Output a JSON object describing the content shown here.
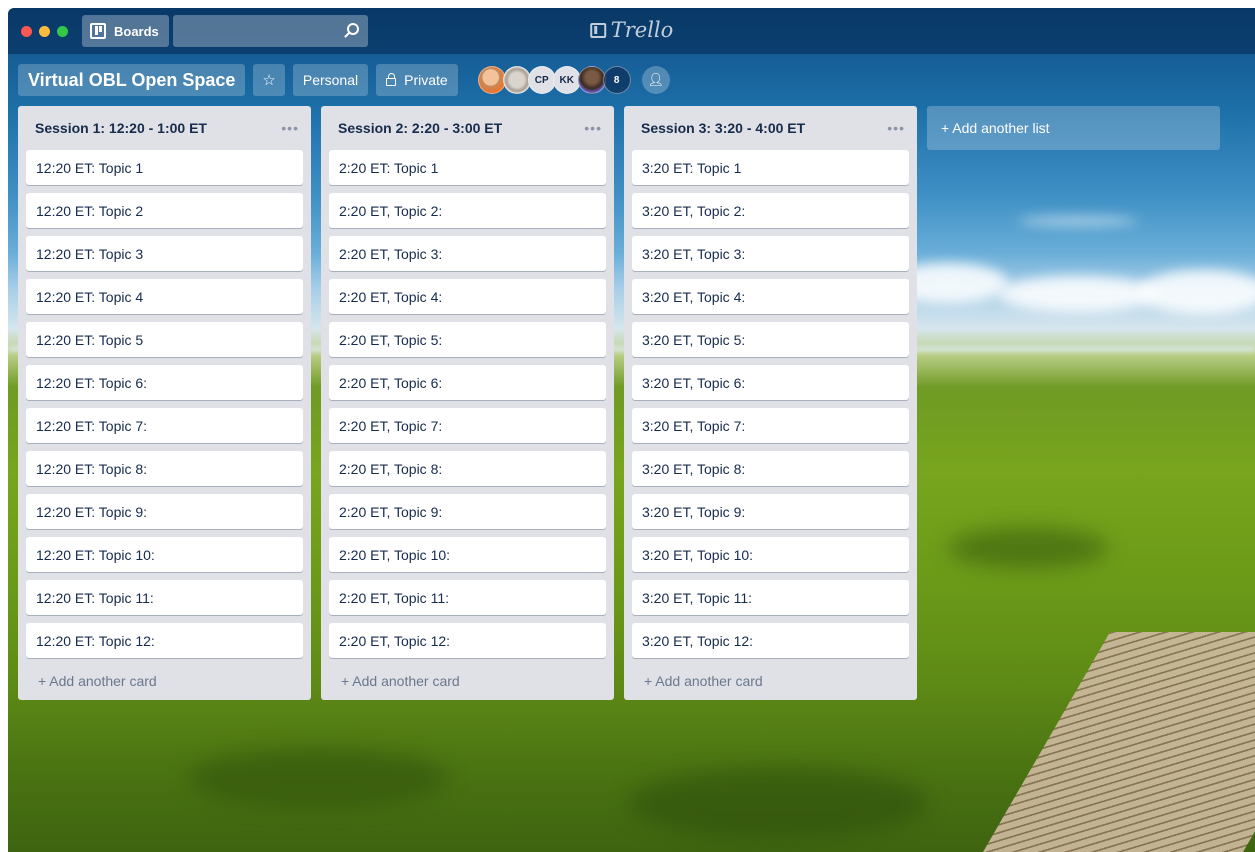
{
  "app": {
    "logo_text": "Trello",
    "boards_label": "Boards",
    "search_value": ""
  },
  "board": {
    "title": "Virtual OBL Open Space",
    "team_label": "Personal",
    "visibility_label": "Private",
    "members": [
      {
        "initials": ""
      },
      {
        "initials": ""
      },
      {
        "initials": "CP"
      },
      {
        "initials": "KK"
      },
      {
        "initials": ""
      }
    ],
    "member_count": "8"
  },
  "lists": [
    {
      "title": "Session 1: 12:20 - 1:00 ET",
      "cards": [
        "12:20 ET: Topic 1",
        "12:20 ET: Topic 2",
        "12:20 ET: Topic 3",
        "12:20 ET: Topic 4",
        "12:20 ET: Topic 5",
        "12:20 ET: Topic 6:",
        "12:20 ET: Topic 7:",
        "12:20 ET: Topic 8:",
        "12:20 ET: Topic 9:",
        "12:20 ET: Topic 10:",
        "12:20 ET: Topic 11:",
        "12:20 ET: Topic 12:"
      ],
      "add_card_label": "+ Add another card"
    },
    {
      "title": "Session 2: 2:20 - 3:00 ET",
      "cards": [
        "2:20 ET: Topic 1",
        "2:20 ET, Topic 2:",
        "2:20 ET, Topic 3:",
        "2:20 ET, Topic 4:",
        "2:20 ET, Topic 5:",
        "2:20 ET, Topic 6:",
        "2:20 ET, Topic 7:",
        "2:20 ET, Topic 8:",
        "2:20 ET, Topic 9:",
        "2:20 ET, Topic 10:",
        "2:20 ET, Topic 11:",
        "2:20 ET, Topic 12:"
      ],
      "add_card_label": "+ Add another card"
    },
    {
      "title": "Session 3: 3:20 - 4:00 ET",
      "cards": [
        "3:20 ET: Topic 1",
        "3:20 ET, Topic 2:",
        "3:20 ET, Topic 3:",
        "3:20 ET, Topic 4:",
        "3:20 ET, Topic 5:",
        "3:20 ET, Topic 6:",
        "3:20 ET, Topic 7:",
        "3:20 ET, Topic 8:",
        "3:20 ET, Topic 9:",
        "3:20 ET, Topic 10:",
        "3:20 ET, Topic 11:",
        "3:20 ET, Topic 12:"
      ],
      "add_card_label": "+ Add another card"
    }
  ],
  "add_list_label": "+ Add another list",
  "list_menu_glyph": "•••",
  "icons": {
    "search": "search-icon",
    "board": "board-icon",
    "star": "star-icon",
    "lock": "lock-icon",
    "add_member": "add-member-icon",
    "list_menu": "more-horizontal-icon"
  },
  "colors": {
    "card_bg": "#ffffff",
    "list_bg": "#dfe1e6",
    "text": "#172b4d",
    "muted_text": "#6b778c"
  }
}
